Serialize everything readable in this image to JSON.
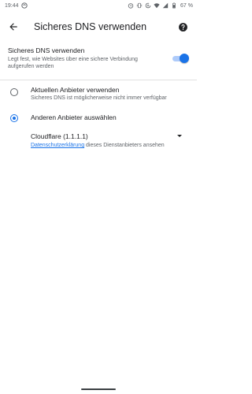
{
  "status_bar": {
    "time": "19:44",
    "battery_percent": "67 %",
    "icons": [
      "app-notification-icon",
      "alarm-icon",
      "vibrate-icon",
      "data-saver-icon",
      "wifi-icon",
      "signal-icon",
      "battery-icon"
    ]
  },
  "toolbar": {
    "title": "Sicheres DNS verwenden",
    "back_icon": "back-arrow-icon",
    "help_icon": "help-icon"
  },
  "secure_dns": {
    "title": "Sicheres DNS verwenden",
    "description": "Legt fest, wie Websites über eine sichere Verbindung aufgerufen werden",
    "enabled": true
  },
  "options": [
    {
      "label": "Aktuellen Anbieter verwenden",
      "description": "Sicheres DNS ist möglicherweise nicht immer verfügbar",
      "selected": false
    },
    {
      "label": "Anderen Anbieter auswählen",
      "selected": true
    }
  ],
  "provider": {
    "selected": "Cloudflare (1.1.1.1)",
    "privacy_link": "Datenschutzerklärung",
    "privacy_suffix": " dieses Dienstanbieters ansehen"
  },
  "colors": {
    "accent": "#1a73e8",
    "track": "#aecbfa",
    "text_primary": "#202124",
    "text_secondary": "#5f6368"
  }
}
